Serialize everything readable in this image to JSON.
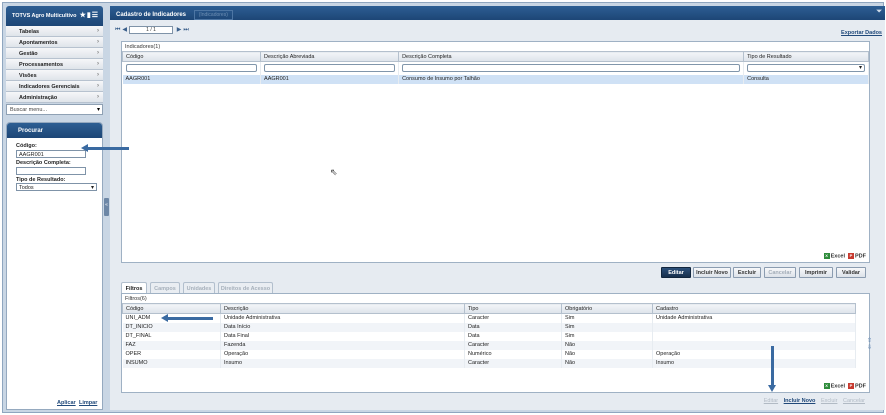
{
  "app": {
    "title": "TOTVS Agro Multicultivo",
    "icons": [
      "star-icon",
      "chart-icon",
      "list-icon"
    ]
  },
  "menu": {
    "items": [
      "Tabelas",
      "Apontamentos",
      "Gestão",
      "Processamentos",
      "Visões",
      "Indicadores Gerenciais",
      "Administração"
    ],
    "search_placeholder": "Buscar menu..."
  },
  "search_panel": {
    "title": "Procurar",
    "codigo_label": "Código:",
    "codigo_value": "AAGR001",
    "descricao_label": "Descrição Completa:",
    "descricao_value": "",
    "tipo_label": "Tipo de Resultado:",
    "tipo_value": "Todos",
    "apply_label": "Aplicar",
    "clear_label": "Limpar"
  },
  "main": {
    "title": "Cadastro de Indicadores",
    "ghost_label": "(Indicadores)",
    "pager": {
      "value": "1 / 1"
    },
    "export_label": "Exportar Dados"
  },
  "indicators": {
    "title": "Indicadores(1)",
    "columns": [
      "Código",
      "Descrição Abreviada",
      "Descrição Completa",
      "Tipo de Resultado"
    ],
    "rows": [
      [
        "AAGR001",
        "AAGR001",
        "Consumo de Insumo por Talhão",
        "Consulta"
      ]
    ]
  },
  "export": {
    "excel": "Excel",
    "pdf": "PDF"
  },
  "buttons": {
    "editar": "Editar",
    "incluir_novo": "Incluir Novo",
    "excluir": "Excluir",
    "cancelar": "Cancelar",
    "imprimir": "Imprimir",
    "validar": "Validar"
  },
  "tabs": [
    "Filtros",
    "Campos",
    "Unidades",
    "Direitos de Acesso"
  ],
  "filters": {
    "title": "Filtros(6)",
    "columns": [
      "Código",
      "Descrição",
      "Tipo",
      "Obrigatório",
      "Cadastro"
    ],
    "rows": [
      [
        "UNI_ADM",
        "Unidade Administrativa",
        "Caracter",
        "Sim",
        "Unidade Administrativa"
      ],
      [
        "DT_INICIO",
        "Data Início",
        "Data",
        "Sim",
        ""
      ],
      [
        "DT_FINAL",
        "Data Final",
        "Data",
        "Sim",
        ""
      ],
      [
        "FAZ",
        "Fazenda",
        "Caracter",
        "Não",
        ""
      ],
      [
        "OPER",
        "Operação",
        "Numérico",
        "Não",
        "Operação"
      ],
      [
        "INSUMO",
        "Insumo",
        "Caracter",
        "Não",
        "Insumo"
      ]
    ]
  },
  "bottom_actions": {
    "editar": "Editar",
    "incluir_novo": "Incluir Novo",
    "excluir": "Excluir",
    "cancelar": "Cancelar"
  }
}
